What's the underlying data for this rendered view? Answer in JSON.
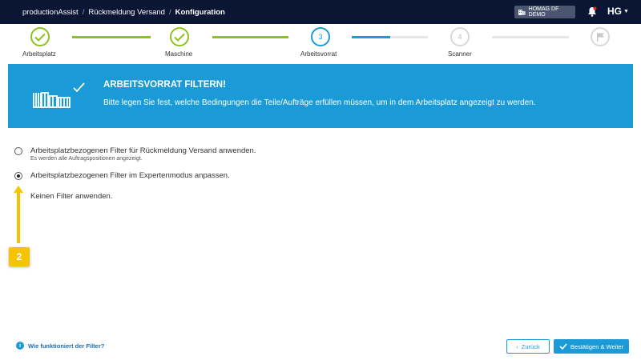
{
  "breadcrumb": {
    "app": "productionAssist",
    "section": "Rückmeldung Versand",
    "current": "Konfiguration"
  },
  "company": "HOMAG DF DEMO",
  "logo_text": "HG",
  "steps": [
    {
      "label": "Arbeitsplatz",
      "state": "done"
    },
    {
      "label": "Maschine",
      "state": "done"
    },
    {
      "number": "3",
      "label": "Arbeitsvorrat",
      "state": "active"
    },
    {
      "number": "4",
      "label": "Scanner",
      "state": "todo"
    },
    {
      "label": "",
      "state": "todo",
      "icon": "flag-icon"
    }
  ],
  "banner": {
    "title": "ARBEITSVORRAT FILTERN!",
    "text": "Bitte legen Sie fest, welche Bedingungen die Teile/Aufträge erfüllen müssen, um in dem Arbeitsplatz angezeigt zu werden."
  },
  "options": [
    {
      "label": "Arbeitsplatzbezogenen Filter für Rückmeldung Versand anwenden.",
      "sub": "Es werden alle Auftragspositionen angezeigt.",
      "checked": false
    },
    {
      "label": "Arbeitsplatzbezogenen Filter im Expertenmodus anpassen.",
      "checked": true
    },
    {
      "label": "Keinen Filter anwenden.",
      "checked": false
    }
  ],
  "marker_number": "2",
  "help_link": "Wie funktioniert der Filter?",
  "buttons": {
    "back": "Zurück",
    "confirm": "Bestätigen & Weiter"
  },
  "colors": {
    "topbar": "#0a1633",
    "accent": "#1a9bd8",
    "done": "#8bc21f",
    "marker": "#f5c400"
  }
}
